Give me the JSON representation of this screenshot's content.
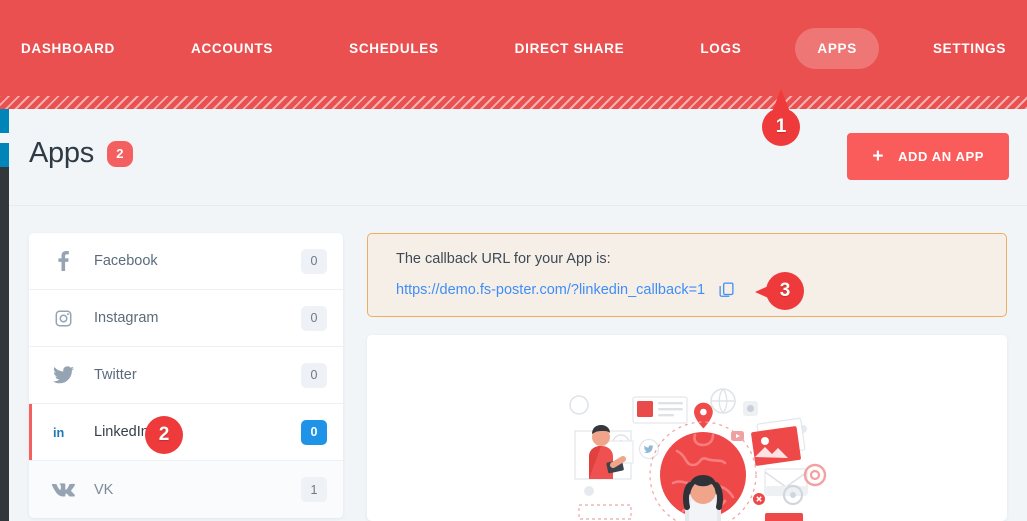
{
  "nav": {
    "items": [
      {
        "label": "DASHBOARD",
        "active": false
      },
      {
        "label": "ACCOUNTS",
        "active": false
      },
      {
        "label": "SCHEDULES",
        "active": false
      },
      {
        "label": "DIRECT SHARE",
        "active": false
      },
      {
        "label": "LOGS",
        "active": false
      },
      {
        "label": "APPS",
        "active": true
      },
      {
        "label": "SETTINGS",
        "active": false
      }
    ]
  },
  "header": {
    "title": "Apps",
    "count": "2",
    "add_button": "ADD AN APP",
    "add_button_icon": "plus-icon"
  },
  "sidebar": {
    "items": [
      {
        "label": "Facebook",
        "icon": "facebook-icon",
        "badge": "0",
        "active": false,
        "highlight": false
      },
      {
        "label": "Instagram",
        "icon": "instagram-icon",
        "badge": "0",
        "active": false,
        "highlight": false
      },
      {
        "label": "Twitter",
        "icon": "twitter-icon",
        "badge": "0",
        "active": false,
        "highlight": false
      },
      {
        "label": "LinkedIn",
        "icon": "linkedin-icon",
        "badge": "0",
        "active": true,
        "highlight": true
      },
      {
        "label": "VK",
        "icon": "vk-icon",
        "badge": "1",
        "active": false,
        "highlight": false
      }
    ]
  },
  "callback": {
    "label": "The callback URL for your App is:",
    "url": "https://demo.fs-poster.com/?linkedin_callback=1",
    "copy_icon": "copy-icon"
  },
  "illustration": {
    "name": "social-network-illustration"
  },
  "markers": [
    {
      "number": "1",
      "target": "apps-nav-tab"
    },
    {
      "number": "2",
      "target": "sidebar-item-linkedin"
    },
    {
      "number": "3",
      "target": "copy-callback-url-button"
    }
  ],
  "colors": {
    "brand_red": "#e9504f",
    "button_red": "#fa5c5c",
    "marker_red": "#ee3a3a",
    "link_blue": "#3f8ef7",
    "badge_blue": "#1e93e8",
    "page_bg": "#f1f5f8",
    "callback_border": "#f0ad5e",
    "callback_bg": "#f6efe7",
    "admin_rail": "#32373c",
    "admin_rail_accent": "#0085ba"
  }
}
